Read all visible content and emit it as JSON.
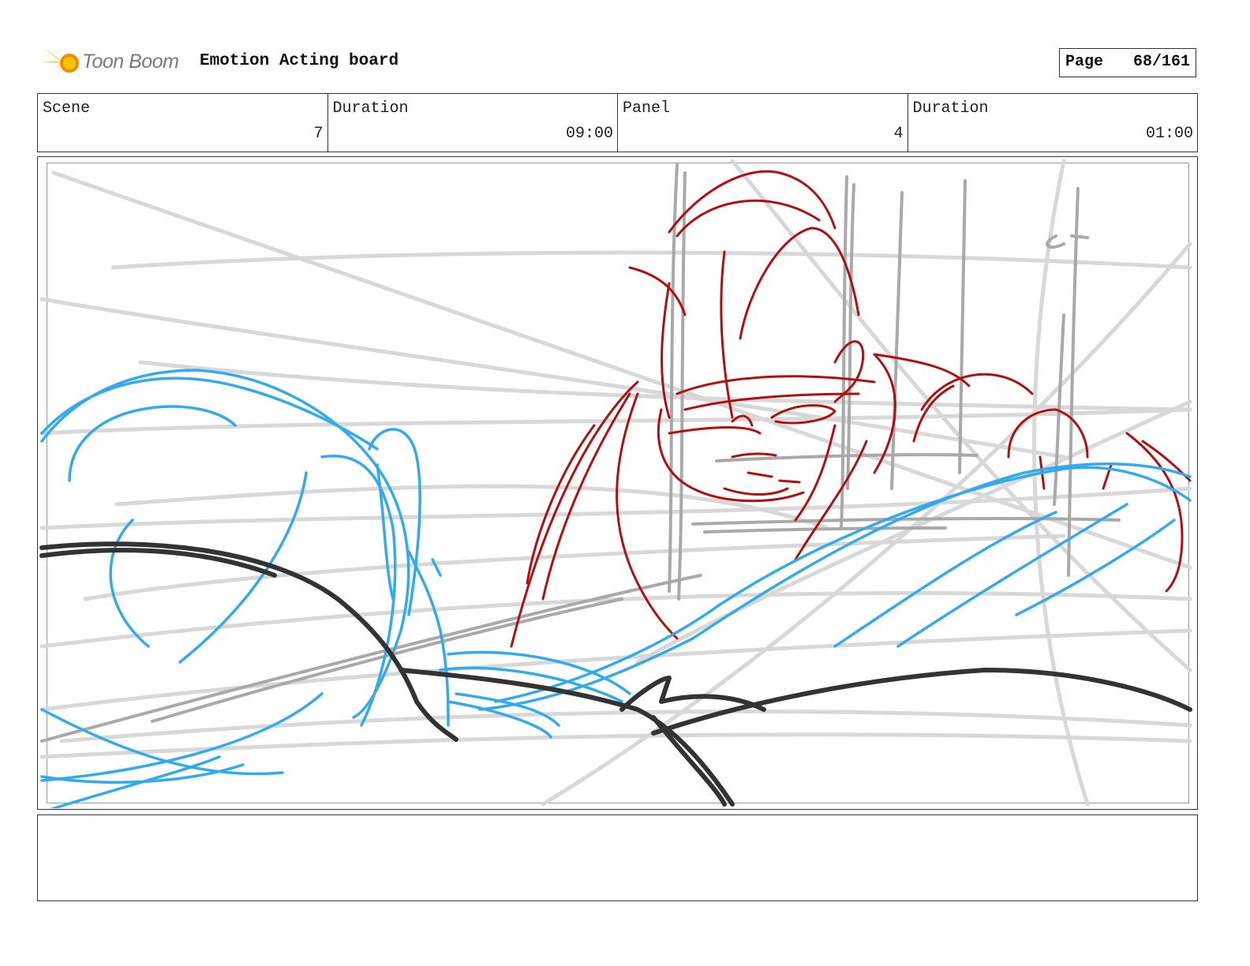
{
  "header": {
    "logo_text": "Toon Boom",
    "board_title": "Emotion Acting board",
    "page_label": "Page",
    "page_number": "68/161"
  },
  "info": {
    "scene_label": "Scene",
    "scene_value": "7",
    "scene_duration_label": "Duration",
    "scene_duration_value": "09:00",
    "panel_label": "Panel",
    "panel_value": "4",
    "panel_duration_label": "Duration",
    "panel_duration_value": "01:00"
  },
  "notes": {
    "text": ""
  },
  "colors": {
    "frame": "#333333",
    "sketch_gray": "#d4d4d4",
    "sketch_dark_gray": "#a8a8a8",
    "sketch_blue": "#33aaee",
    "sketch_red": "#b01010",
    "sketch_black": "#333333",
    "logo_yellow": "#f5c400",
    "logo_orange": "#f08a00"
  }
}
